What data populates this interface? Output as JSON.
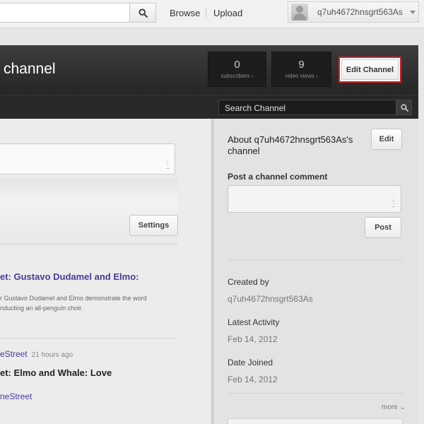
{
  "masthead": {
    "search_value": "",
    "browse_label": "Browse",
    "upload_label": "Upload",
    "account_name": "q7uh4672hnsgrt563As"
  },
  "header": {
    "title": "channel",
    "stats": [
      {
        "value": "0",
        "label": "subscribers ›"
      },
      {
        "value": "9",
        "label": "video views ›"
      }
    ],
    "edit_channel_label": "Edit Channel",
    "highlight_color": "#d81f26"
  },
  "channel_nav": {
    "search_value": "Search Channel"
  },
  "left": {
    "settings_label": "Settings",
    "feed": [
      {
        "title": "et: Gustavo Dudamel and Elmo:",
        "desc_line1": "r Gustavo Dudamel and Elmo demonstrate the word",
        "desc_line2": "nducting an all-penguin choir."
      },
      {
        "source": "eStreet",
        "time": "21 hours ago",
        "title": "et: Elmo and Whale: Love",
        "source2": "neStreet"
      }
    ],
    "link_color": "#4a3a99"
  },
  "right": {
    "about_title": "About q7uh4672hnsgrt563As's channel",
    "edit_label": "Edit",
    "post_comment_label": "Post a channel comment",
    "post_label": "Post",
    "created_by_label": "Created by",
    "created_by_value": "q7uh4672hnsgrt563As",
    "latest_activity_label": "Latest Activity",
    "latest_activity_value": "Feb 14, 2012",
    "date_joined_label": "Date Joined",
    "date_joined_value": "Feb 14, 2012",
    "more_label": "more"
  },
  "icons": [
    "search-icon",
    "avatar",
    "chevron-down-icon",
    "resize-grip-icon"
  ]
}
